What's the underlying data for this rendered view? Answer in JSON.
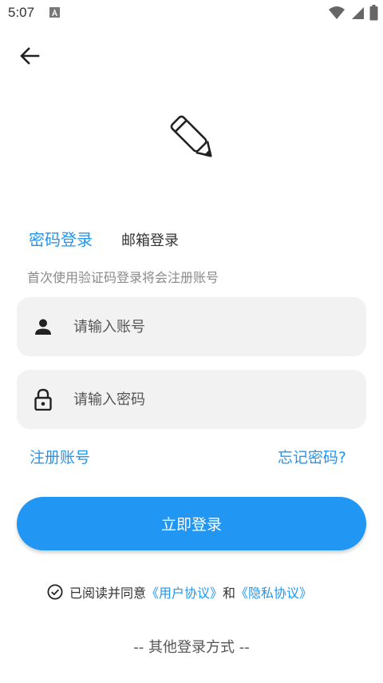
{
  "status_bar": {
    "time": "5:07",
    "icons": [
      "notification-a-icon",
      "wifi-icon",
      "signal-icon",
      "battery-icon"
    ]
  },
  "colors": {
    "accent": "#2196F3",
    "field_bg": "#f2f2f2",
    "hint": "#8a8a8a"
  },
  "header": {
    "back_icon": "arrow-left-icon",
    "logo_icon": "pencil-icon"
  },
  "tabs": {
    "active": "密码登录",
    "inactive": "邮箱登录"
  },
  "hint": "首次使用验证码登录将会注册账号",
  "form": {
    "account": {
      "placeholder": "请输入账号",
      "value": "",
      "icon": "person-icon"
    },
    "password": {
      "placeholder": "请输入密码",
      "value": "",
      "icon": "lock-icon"
    }
  },
  "links": {
    "register": "注册账号",
    "forgot": "忘记密码?"
  },
  "login_button": "立即登录",
  "agreement": {
    "prefix": "已阅读并同意",
    "user_agreement": "《用户协议》",
    "and": "和",
    "privacy_agreement": "《隐私协议》",
    "checked": true
  },
  "other_login": "-- 其他登录方式 --"
}
